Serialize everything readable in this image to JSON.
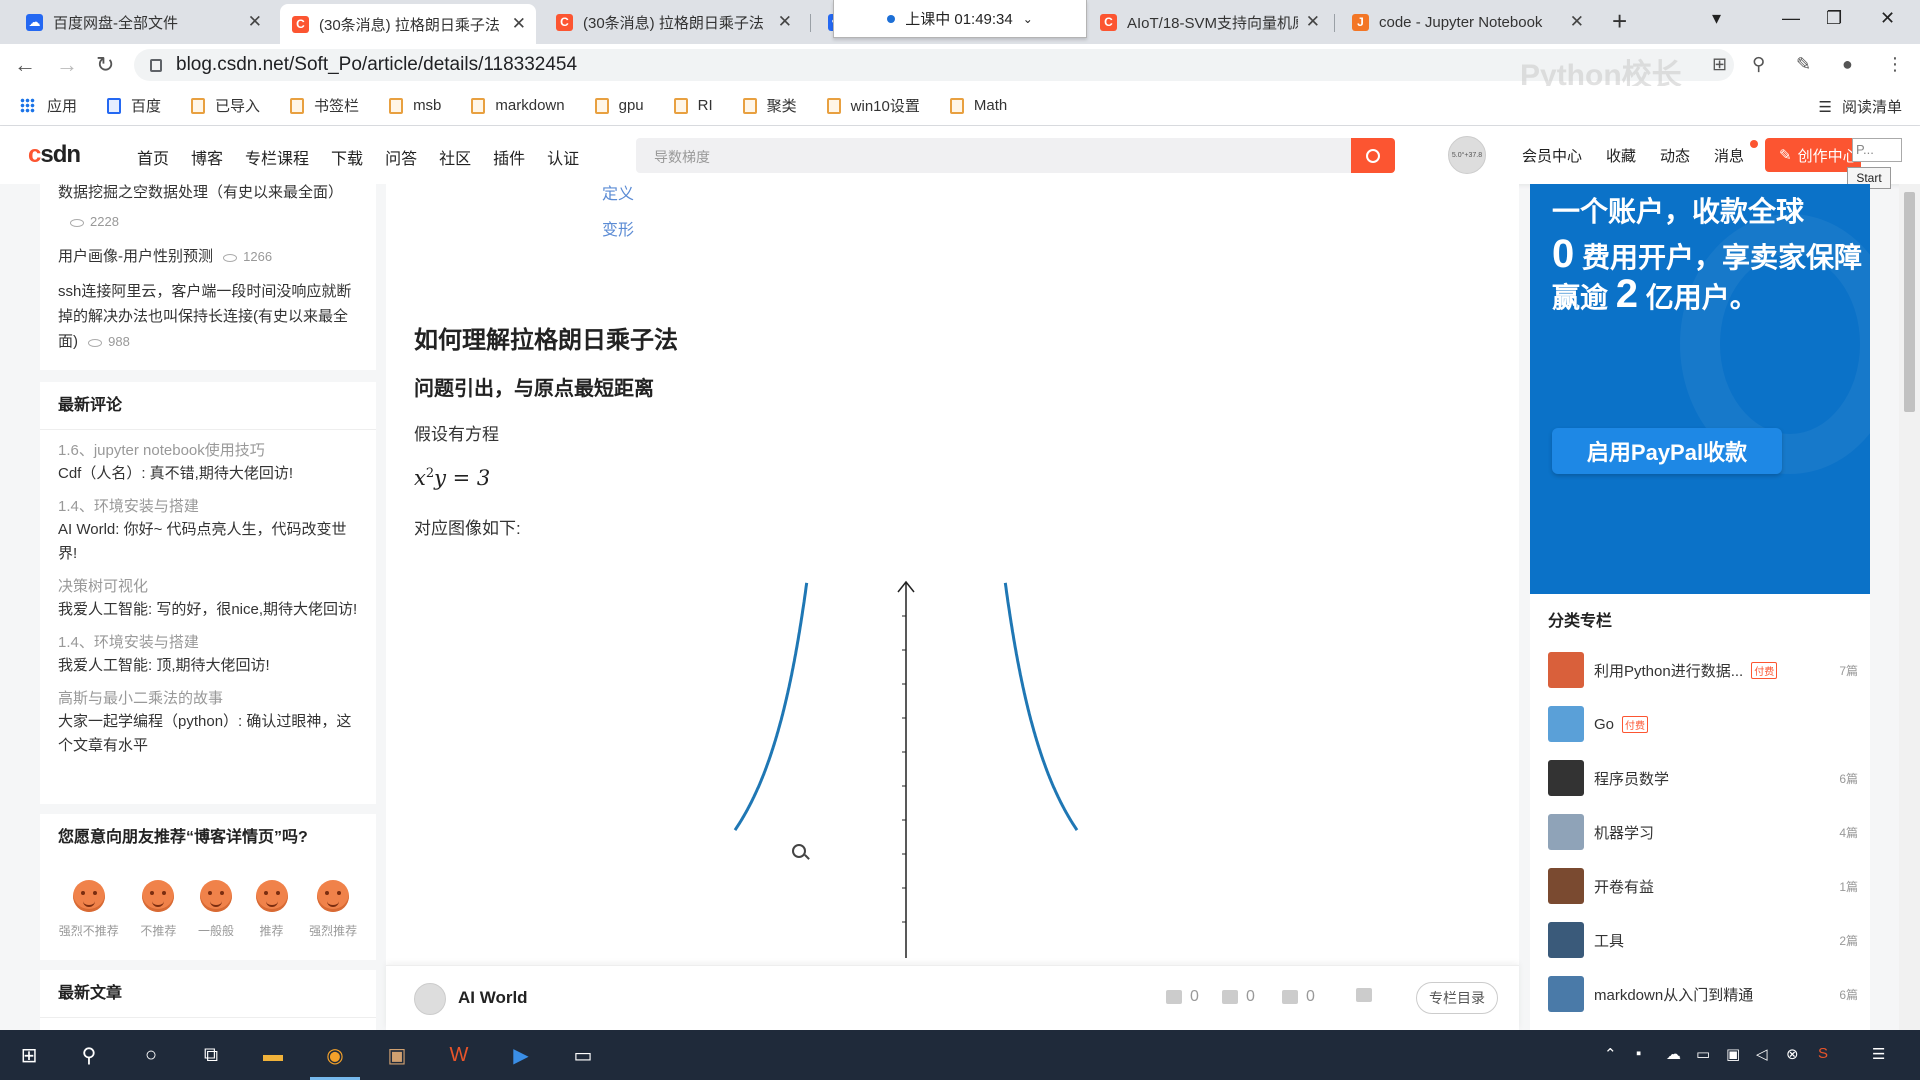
{
  "browser": {
    "tabs": [
      {
        "title": "百度网盘-全部文件",
        "favicon": "baidu-pan-icon",
        "color": "#2468f2"
      },
      {
        "title": "(30条消息) 拉格朗日乘子法",
        "favicon": "csdn-icon",
        "color": "#fc5531"
      },
      {
        "title": "(30条消息) 拉格朗日乘子法",
        "favicon": "csdn-icon",
        "color": "#fc5531"
      },
      {
        "title": "AIoT/18-SVM支持向量机原",
        "favicon": "csdn-icon",
        "color": "#fc5531"
      },
      {
        "title": "code - Jupyter Notebook",
        "favicon": "jupyter-icon",
        "color": "#f37626"
      }
    ],
    "timer": "上课中 01:49:34",
    "url": "blog.csdn.net/Soft_Po/article/details/118332454",
    "bookmarks": [
      "应用",
      "百度",
      "已导入",
      "书签栏",
      "msb",
      "markdown",
      "gpu",
      "RI",
      "聚类",
      "win10设置",
      "Math"
    ],
    "reading_list": "阅读清单",
    "watermark": "Python校长"
  },
  "csdn": {
    "logo_c": "c",
    "logo_rest": "sdn",
    "nav": [
      "首页",
      "博客",
      "专栏课程",
      "下载",
      "问答",
      "社区",
      "插件",
      "认证"
    ],
    "search_placeholder": "导数梯度",
    "avatar_text": "5.0°+37.8",
    "right_nav": [
      "会员中心",
      "收藏",
      "动态",
      "消息"
    ],
    "create_label": "创作中心",
    "p_label": "P...",
    "start_label": "Start"
  },
  "left": {
    "hot": [
      {
        "title": "数据挖掘之空数据处理（有史以来最全面）",
        "views": "2228"
      },
      {
        "title": "用户画像-用户性别预测",
        "views": "1266"
      },
      {
        "title": "ssh连接阿里云，客户端一段时间没响应就断掉的解决办法也叫保持长连接(有史以来最全面)",
        "views": "988"
      }
    ],
    "comments_title": "最新评论",
    "comments": [
      {
        "article": "1.6、jupyter notebook使用技巧",
        "text": "Cdf（人名）: 真不错,期待大佬回访!"
      },
      {
        "article": "1.4、环境安装与搭建",
        "text": "AI World: 你好~ 代码点亮人生，代码改变世界!"
      },
      {
        "article": "决策树可视化",
        "text": "我爱人工智能: 写的好，很nice,期待大佬回访!"
      },
      {
        "article": "1.4、环境安装与搭建",
        "text": "我爱人工智能: 顶,期待大佬回访!"
      },
      {
        "article": "高斯与最小二乘法的故事",
        "text": "大家一起学编程（python）: 确认过眼神，这个文章有水平"
      }
    ],
    "recommend_title": "您愿意向朋友推荐“博客详情页”吗?",
    "faces": [
      "强烈不推荐",
      "不推荐",
      "一般般",
      "推荐",
      "强烈推荐"
    ],
    "latest_title": "最新文章"
  },
  "article": {
    "toc_items": [
      "定义",
      "变形"
    ],
    "h1": "如何理解拉格朗日乘子法",
    "h2": "问题引出，与原点最短距离",
    "p1": "假设有方程",
    "eq_x": "x",
    "eq_exp": "2",
    "eq_rest": "y = 3",
    "p2": "对应图像如下:",
    "curve_color": "#1f77b4"
  },
  "bottom": {
    "author": "AI World",
    "likes": "0",
    "comments": "0",
    "stars": "0",
    "column_btn": "专栏目录"
  },
  "ad": {
    "l1": "一个账户，收款全球",
    "l2a": "0",
    "l2b": " 费用开户，享卖家保障",
    "l3a": "赢逾 ",
    "l3b": "2",
    "l3c": " 亿用户。",
    "button": "启用PayPal收款"
  },
  "categories": {
    "title": "分类专栏",
    "items": [
      {
        "name": "利用Python进行数据...",
        "paid": "付费",
        "count": "7篇",
        "color": "#d9603b"
      },
      {
        "name": "Go",
        "paid": "付费",
        "count": "",
        "color": "#5aa0d8"
      },
      {
        "name": "程序员数学",
        "paid": "",
        "count": "6篇",
        "color": "#333333"
      },
      {
        "name": "机器学习",
        "paid": "",
        "count": "4篇",
        "color": "#8fa3b8"
      },
      {
        "name": "开卷有益",
        "paid": "",
        "count": "1篇",
        "color": "#7a4a30"
      },
      {
        "name": "工具",
        "paid": "",
        "count": "2篇",
        "color": "#3a5a7a"
      },
      {
        "name": "markdown从入门到精通",
        "paid": "",
        "count": "6篇",
        "color": "#4a7aa8"
      }
    ]
  }
}
